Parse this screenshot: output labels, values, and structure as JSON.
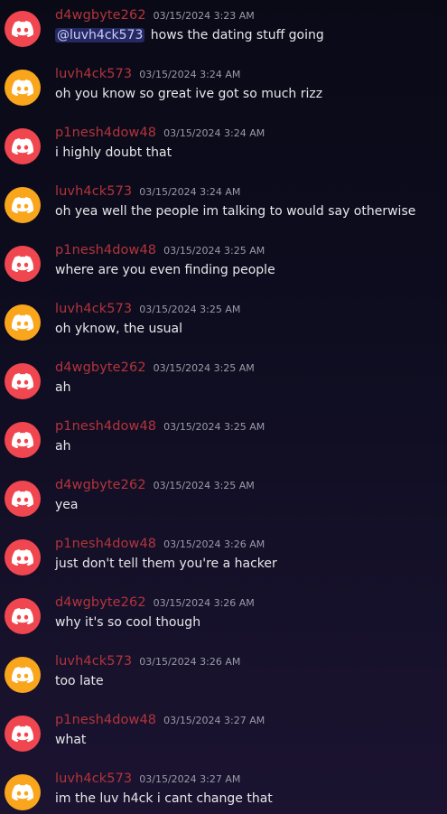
{
  "colors": {
    "red": "#f0464f",
    "yellow": "#f9a61d",
    "username": "#b3343b",
    "mention_bg": "#3b3f79"
  },
  "icons": {
    "avatar": "discord-logo-icon"
  },
  "messages": [
    {
      "author": "d4wgbyte262",
      "avatar": "red",
      "timestamp": "03/15/2024 3:23 AM",
      "mention": "@luvh4ck573",
      "text": " hows the dating stuff going"
    },
    {
      "author": "luvh4ck573",
      "avatar": "yellow",
      "timestamp": "03/15/2024 3:24 AM",
      "text": "oh you know so great ive got so much rizz"
    },
    {
      "author": "p1nesh4dow48",
      "avatar": "red",
      "timestamp": "03/15/2024 3:24 AM",
      "text": "i highly doubt that"
    },
    {
      "author": "luvh4ck573",
      "avatar": "yellow",
      "timestamp": "03/15/2024 3:24 AM",
      "text": "oh yea well the people im talking to would say otherwise"
    },
    {
      "author": "p1nesh4dow48",
      "avatar": "red",
      "timestamp": "03/15/2024 3:25 AM",
      "text": "where are you even finding people"
    },
    {
      "author": "luvh4ck573",
      "avatar": "yellow",
      "timestamp": "03/15/2024 3:25 AM",
      "text": "oh yknow, the usual"
    },
    {
      "author": "d4wgbyte262",
      "avatar": "red",
      "timestamp": "03/15/2024 3:25 AM",
      "text": "ah"
    },
    {
      "author": "p1nesh4dow48",
      "avatar": "red",
      "timestamp": "03/15/2024 3:25 AM",
      "text": "ah"
    },
    {
      "author": "d4wgbyte262",
      "avatar": "red",
      "timestamp": "03/15/2024 3:25 AM",
      "text": "yea"
    },
    {
      "author": "p1nesh4dow48",
      "avatar": "red",
      "timestamp": "03/15/2024 3:26 AM",
      "text": "just don't tell them you're a hacker"
    },
    {
      "author": "d4wgbyte262",
      "avatar": "red",
      "timestamp": "03/15/2024 3:26 AM",
      "text": "why it's so cool though"
    },
    {
      "author": "luvh4ck573",
      "avatar": "yellow",
      "timestamp": "03/15/2024 3:26 AM",
      "text": "too late"
    },
    {
      "author": "p1nesh4dow48",
      "avatar": "red",
      "timestamp": "03/15/2024 3:27 AM",
      "text": "what"
    },
    {
      "author": "luvh4ck573",
      "avatar": "yellow",
      "timestamp": "03/15/2024 3:27 AM",
      "text": "im the luv h4ck i cant change that"
    }
  ]
}
